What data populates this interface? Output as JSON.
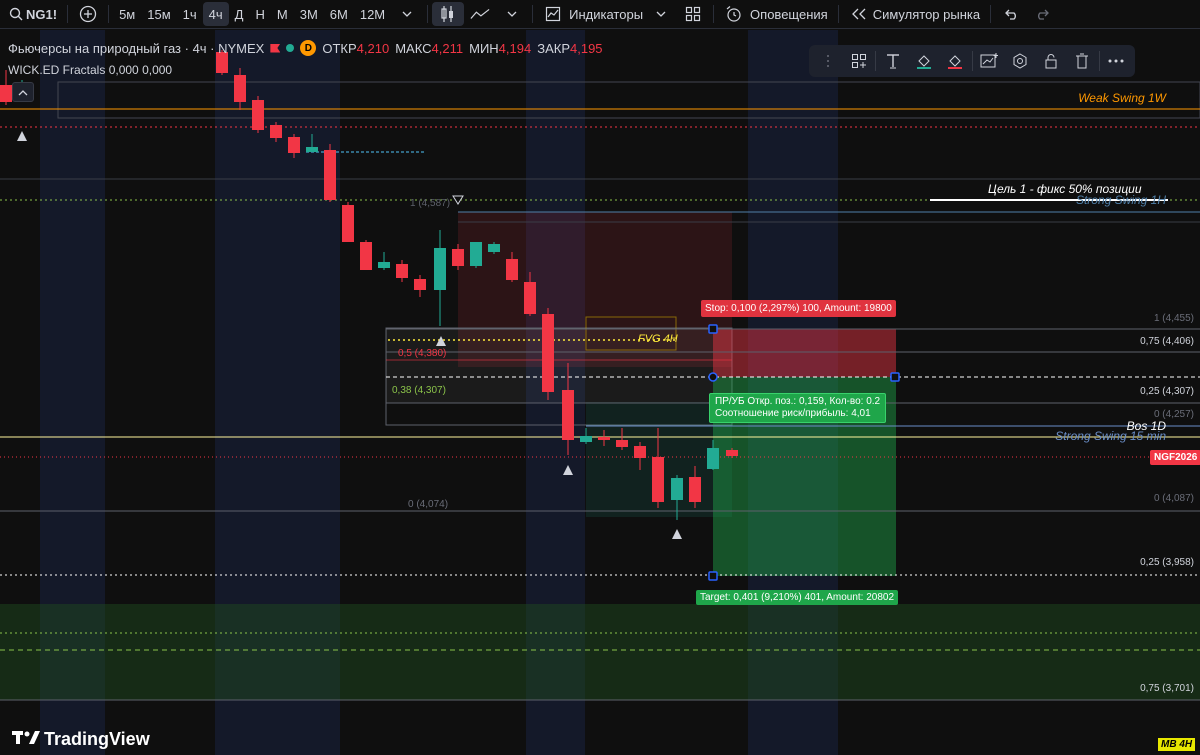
{
  "toolbar": {
    "symbol": "NG1!",
    "intervals": [
      "5м",
      "15м",
      "1ч",
      "4ч",
      "Д",
      "Н",
      "М",
      "3М",
      "6М",
      "12М"
    ],
    "active_interval": "4ч",
    "indicators_label": "Индикаторы",
    "alerts_label": "Оповещения",
    "replay_label": "Симулятор рынка"
  },
  "legend": {
    "title": "Фьючерсы на природный газ · 4ч · NYMEX",
    "d_badge": "D",
    "open_label": "ОТКР",
    "open_value": "4,210",
    "high_label": "МАКС",
    "high_value": "4,211",
    "low_label": "МИН",
    "low_value": "4,194",
    "close_label": "ЗАКР",
    "close_value": "4,195",
    "indicator": "WICK.ED Fractals",
    "indicator_v1": "0,000",
    "indicator_v2": "0,000"
  },
  "annotations": {
    "weak_swing": "Weak Swing 1W",
    "goal": "Цель 1 - фикс 50% позиции",
    "strong_swing_1h": "Strong Swing 1H",
    "fvg": "FVG 4H",
    "bos": "Bos 1D",
    "strong_swing_15": "Strong Swing 15 min",
    "mb": "MB 4H",
    "fib_top_left": "1 (4,587)"
  },
  "position": {
    "stop": "Stop: 0,100 (2,297%) 100, Amount: 19800",
    "target": "Target: 0,401 (9,210%) 401, Amount: 20802",
    "pnl_line": "ПР/УБ Откр. поз.: 0,159, Кол-во: 0.2",
    "rr_line": "Соотношение риск/прибыль: 4,01"
  },
  "fib_right": [
    {
      "text": "1 (4,455)",
      "dim": true
    },
    {
      "text": "0,75 (4,406)",
      "dim": false
    },
    {
      "text": "0,25 (4,307)",
      "dim": false
    },
    {
      "text": "0 (4,257)",
      "dim": true
    },
    {
      "text": "0 (4,087)",
      "dim": true
    },
    {
      "text": "0,25 (3,958)",
      "dim": false
    },
    {
      "text": "0,75 (3,701)",
      "dim": false
    }
  ],
  "fib_left": [
    {
      "text": "0,5 (4,380)"
    },
    {
      "text": "0,38 (4,307)"
    },
    {
      "text": "0 (4,074)"
    }
  ],
  "price_badge": "NGF2026",
  "brand": "TradingView",
  "colors": {
    "up": "#22ab94",
    "down": "#f23645",
    "bg": "#0f0f0f"
  }
}
